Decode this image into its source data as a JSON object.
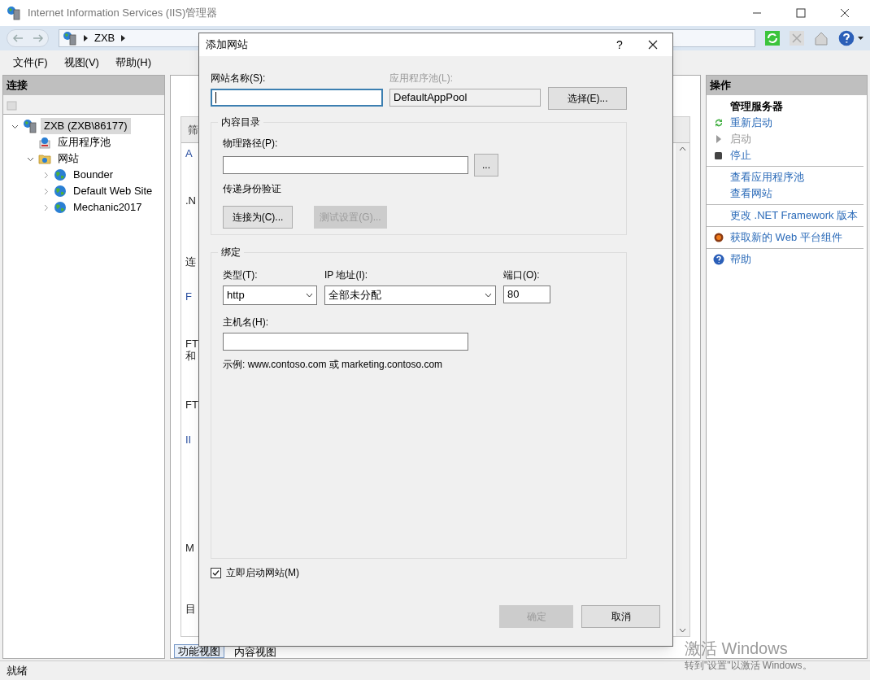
{
  "window": {
    "title": "Internet Information Services (IIS)管理器"
  },
  "address": {
    "path": [
      "ZXB"
    ]
  },
  "menu": [
    "文件(F)",
    "视图(V)",
    "帮助(H)"
  ],
  "connections": {
    "title": "连接",
    "tree": [
      {
        "label": "ZXB (ZXB\\86177)",
        "kind": "server",
        "expanded": true,
        "selected": true,
        "children": [
          {
            "label": "应用程序池",
            "kind": "pool",
            "selected": false
          },
          {
            "label": "网站",
            "kind": "folder",
            "expanded": true,
            "selected": false,
            "children": [
              {
                "label": "Bounder",
                "kind": "site",
                "expanded": false,
                "selected": false
              },
              {
                "label": "Default Web Site",
                "kind": "site",
                "expanded": false,
                "selected": false
              },
              {
                "label": "Mechanic2017",
                "kind": "site",
                "expanded": false,
                "selected": false
              }
            ]
          }
        ]
      }
    ]
  },
  "center": {
    "header_fragment": "筛",
    "fragments": [
      {
        "text": "A",
        "kind": "link"
      },
      {
        "text": ".N",
        "kind": "text"
      },
      {
        "text": "连",
        "kind": "text"
      },
      {
        "text": "F",
        "kind": "link"
      },
      {
        "text": "FT\n和",
        "kind": "text"
      },
      {
        "text": "FT",
        "kind": "text"
      },
      {
        "text": "II",
        "kind": "link"
      },
      {
        "text": "M",
        "kind": "text"
      },
      {
        "text": "目",
        "kind": "text"
      }
    ],
    "view_tabs": [
      {
        "label": "功能视图",
        "selected": true
      },
      {
        "label": "内容视图",
        "selected": false
      }
    ]
  },
  "actions": {
    "title": "操作",
    "items": [
      {
        "kind": "header",
        "label": "管理服务器",
        "disabled": false,
        "divider": false
      },
      {
        "kind": "restart",
        "label": "重新启动",
        "disabled": false,
        "divider": false
      },
      {
        "kind": "start",
        "label": "启动",
        "disabled": true,
        "divider": false
      },
      {
        "kind": "stop",
        "label": "停止",
        "disabled": false,
        "divider": true
      },
      {
        "kind": "link",
        "label": "查看应用程序池",
        "disabled": false,
        "divider": false
      },
      {
        "kind": "link",
        "label": "查看网站",
        "disabled": false,
        "divider": true
      },
      {
        "kind": "link",
        "label": "更改 .NET Framework 版本",
        "disabled": false,
        "divider": true
      },
      {
        "kind": "platform",
        "label": "获取新的 Web 平台组件",
        "disabled": false,
        "divider": true
      },
      {
        "kind": "help",
        "label": "帮助",
        "disabled": false,
        "divider": false
      }
    ]
  },
  "dialog": {
    "title": "添加网站",
    "help": "?",
    "site_name": {
      "label": "网站名称(S):"
    },
    "app_pool": {
      "label": "应用程序池(L):",
      "value": "DefaultAppPool",
      "disabled": true
    },
    "select_button": "选择(E)...",
    "content": {
      "title": "内容目录",
      "path_label": "物理路径(P):",
      "browse": "...",
      "auth_label": "传递身份验证",
      "connect_as": {
        "label": "连接为(C)...",
        "disabled": false
      },
      "test": {
        "label": "测试设置(G)...",
        "disabled": true
      }
    },
    "binding": {
      "title": "绑定",
      "type": {
        "label": "类型(T):",
        "value": "http"
      },
      "ip": {
        "label": "IP 地址(I):",
        "value": "全部未分配"
      },
      "port": {
        "label": "端口(O):",
        "value": "80"
      },
      "host": {
        "label": "主机名(H):"
      },
      "example": "示例: www.contoso.com 或 marketing.contoso.com"
    },
    "start": {
      "label": "立即启动网站(M)",
      "checked": true
    },
    "ok": {
      "label": "确定",
      "disabled": true
    },
    "cancel": {
      "label": "取消",
      "disabled": false
    }
  },
  "status_bar": "就绪",
  "activation": {
    "title": "激活 Windows",
    "subtitle": "转到\"设置\"以激活 Windows。"
  }
}
